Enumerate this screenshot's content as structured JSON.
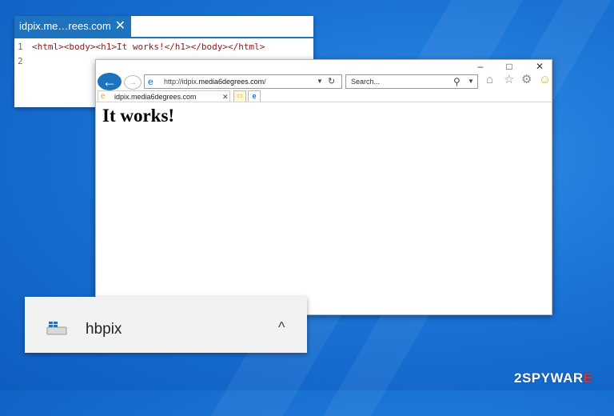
{
  "source_window": {
    "tab_title": "idpix.me…rees.com",
    "close_glyph": "✕",
    "lines": [
      {
        "number": "1",
        "code": "<html><body><h1>It works!</h1></body></html>"
      },
      {
        "number": "2",
        "code": ""
      }
    ]
  },
  "browser": {
    "window_controls": {
      "minimize": "–",
      "maximize": "□",
      "close": "✕"
    },
    "back_icon": "arrow-left-icon",
    "address": {
      "prefix": "http://idpix.",
      "domain": "media6degrees.com",
      "suffix": "/"
    },
    "search": {
      "placeholder": "Search..."
    },
    "tab": {
      "title": "idpix.media6degrees.com",
      "close": "✕"
    },
    "page": {
      "heading": "It works!"
    },
    "toolbar_icons": [
      "home-icon",
      "favorites-star-icon",
      "settings-gear-icon",
      "smiley-feedback-icon"
    ]
  },
  "notification": {
    "app_name": "hbpix",
    "chevron": "^"
  },
  "watermark": {
    "text_a": "2SPYWAR",
    "text_b": "E"
  }
}
